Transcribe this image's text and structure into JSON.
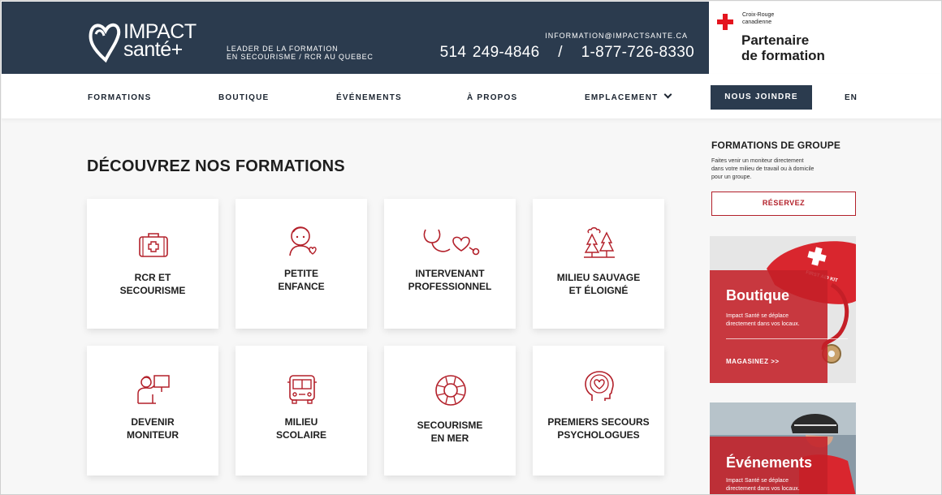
{
  "header": {
    "logo_line1": "IMPACT",
    "logo_line2": "santé+",
    "tagline_line1": "LEADER DE LA FORMATION",
    "tagline_line2": "EN SECOURISME / RCR AU QUEBEC",
    "email": "INFORMATION@IMPACTSANTE.CA",
    "phones": "514 249-4846   /   1-877-726-8330"
  },
  "partner": {
    "cr_line1": "Croix-Rouge",
    "cr_line2": "canadienne",
    "title_line1": "Partenaire",
    "title_line2": "de formation"
  },
  "nav": {
    "items": [
      "FORMATIONS",
      "BOUTIQUE",
      "ÉVÉNEMENTS",
      "À PROPOS",
      "EMPLACEMENT"
    ],
    "join": "NOUS JOINDRE",
    "lang": "EN"
  },
  "main": {
    "title": "DÉCOUVREZ NOS FORMATIONS",
    "cards": [
      {
        "line1": "RCR ET",
        "line2": "SECOURISME",
        "icon": "first-aid-kit-icon"
      },
      {
        "line1": "PETITE",
        "line2": "ENFANCE",
        "icon": "child-icon"
      },
      {
        "line1": "INTERVENANT",
        "line2": "PROFESSIONNEL",
        "icon": "stethoscope-icon"
      },
      {
        "line1": "MILIEU SAUVAGE",
        "line2": "ET ÉLOIGNÉ",
        "icon": "trees-icon"
      },
      {
        "line1": "DEVENIR",
        "line2": "MONITEUR",
        "icon": "instructor-icon"
      },
      {
        "line1": "MILIEU",
        "line2": "SCOLAIRE",
        "icon": "school-bus-icon"
      },
      {
        "line1": "SECOURISME",
        "line2": "EN MER",
        "icon": "lifebuoy-icon"
      },
      {
        "line1": "PREMIERS SECOURS",
        "line2": "PSYCHOLOGUES",
        "icon": "head-heart-icon"
      }
    ]
  },
  "sidebar": {
    "group_title": "FORMATIONS DE GROUPE",
    "group_desc_line1": "Faites venir un moniteur directement",
    "group_desc_line2": "dans votre milieu de travail ou à domicile",
    "group_desc_line3": "pour un groupe.",
    "reserve": "RÉSERVEZ",
    "shop_title": "Boutique",
    "shop_desc": "Impact Santé se déplace directement dans vos locaux.",
    "shop_link": "MAGASINEZ >>",
    "kit_label": "FIRST AID KIT",
    "events_title": "Événements",
    "events_desc": "Impact Santé se déplace directement dans vos locaux."
  },
  "colors": {
    "navy": "#2b3b4e",
    "accent_red": "#b3202a",
    "cross_red": "#e4141e"
  }
}
